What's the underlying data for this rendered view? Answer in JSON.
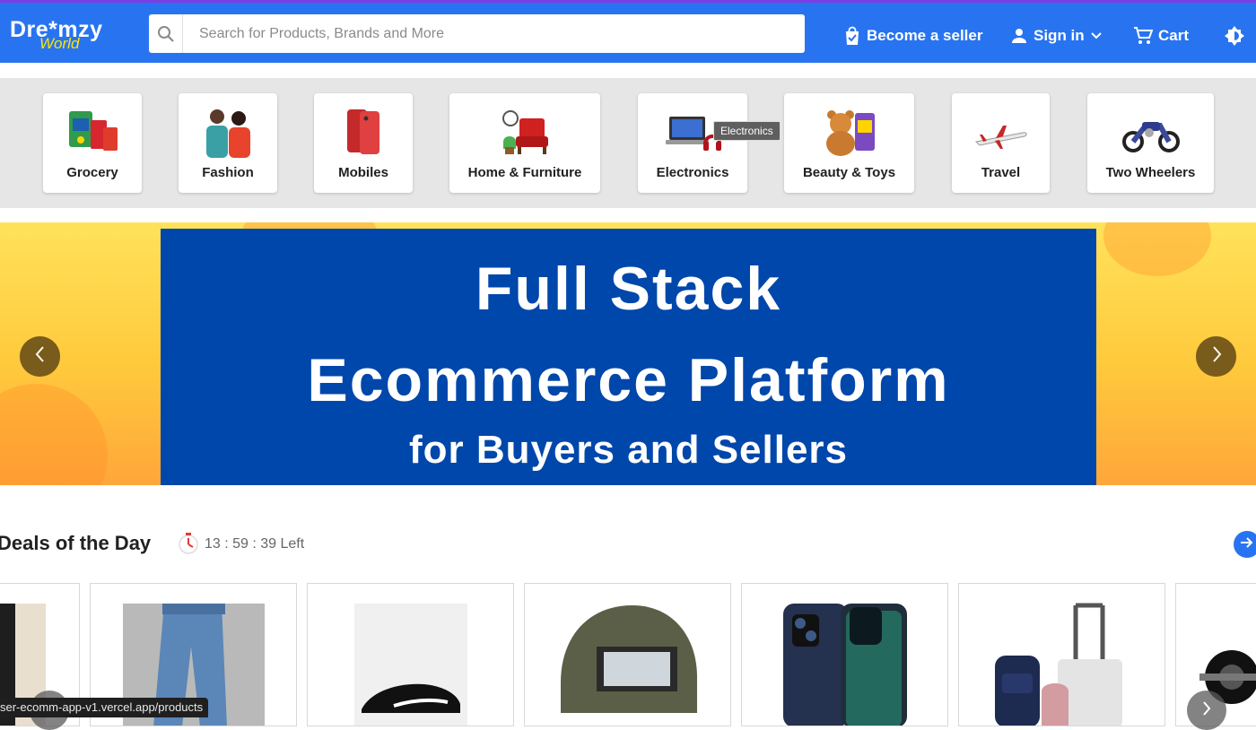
{
  "header": {
    "logo_main": "Dre*mzy",
    "logo_sub": "World",
    "search_placeholder": "Search for Products, Brands and More",
    "become_seller": "Become a seller",
    "sign_in": "Sign in",
    "cart": "Cart"
  },
  "categories": [
    {
      "label": "Grocery",
      "icon": "grocery-icon"
    },
    {
      "label": "Fashion",
      "icon": "fashion-icon"
    },
    {
      "label": "Mobiles",
      "icon": "mobiles-icon"
    },
    {
      "label": "Home & Furniture",
      "icon": "home-furniture-icon"
    },
    {
      "label": "Electronics",
      "icon": "electronics-icon"
    },
    {
      "label": "Beauty & Toys",
      "icon": "beauty-toys-icon"
    },
    {
      "label": "Travel",
      "icon": "travel-icon"
    },
    {
      "label": "Two Wheelers",
      "icon": "two-wheelers-icon"
    }
  ],
  "tooltip": "Electronics",
  "banner": {
    "line1": "Full Stack",
    "line2": "Ecommerce Platform",
    "line3": "for Buyers and Sellers"
  },
  "deals": {
    "title": "Deals of the Day",
    "timer": "13 : 59 : 39 Left",
    "products": [
      {
        "icon": "trousers-icon"
      },
      {
        "icon": "jeans-icon"
      },
      {
        "icon": "sneaker-icon"
      },
      {
        "icon": "helmet-icon"
      },
      {
        "icon": "phone-case-icon"
      },
      {
        "icon": "luggage-icon"
      },
      {
        "icon": "fitness-wheel-icon"
      }
    ]
  },
  "status_url": "ser-ecomm-app-v1.vercel.app/products",
  "colors": {
    "brand_blue": "#2874f0",
    "logo_yellow": "#ffe500",
    "banner_blue": "#0047ab"
  }
}
